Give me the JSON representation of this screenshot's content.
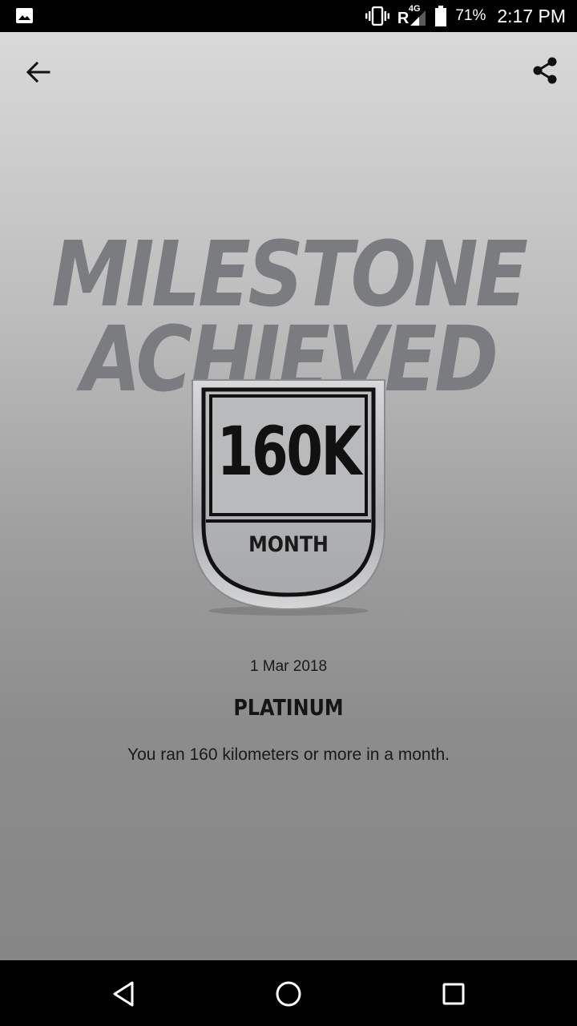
{
  "status_bar": {
    "network_roaming": "R",
    "network_type": "4G",
    "battery_percent": "71%",
    "time": "2:17 PM",
    "icons": [
      "image-notification-icon",
      "vibrate-icon",
      "signal-icon",
      "battery-icon"
    ]
  },
  "toolbar": {
    "back_icon": "arrow-back-icon",
    "share_icon": "share-icon"
  },
  "hero": {
    "headline_line1": "MILESTONE",
    "headline_line2": "ACHIEVED"
  },
  "badge": {
    "value": "160K",
    "period": "MONTH"
  },
  "achievement": {
    "date": "1 Mar 2018",
    "level": "PLATINUM",
    "description": "You ran 160 kilometers or more in a month."
  },
  "nav_bar": {
    "icons": [
      "nav-back-icon",
      "nav-home-icon",
      "nav-recents-icon"
    ]
  },
  "colors": {
    "headline": "#7b7c80",
    "badge_outline": "#111111",
    "badge_fill": "#b4b5b7",
    "text_dark": "#1a1a1a"
  }
}
